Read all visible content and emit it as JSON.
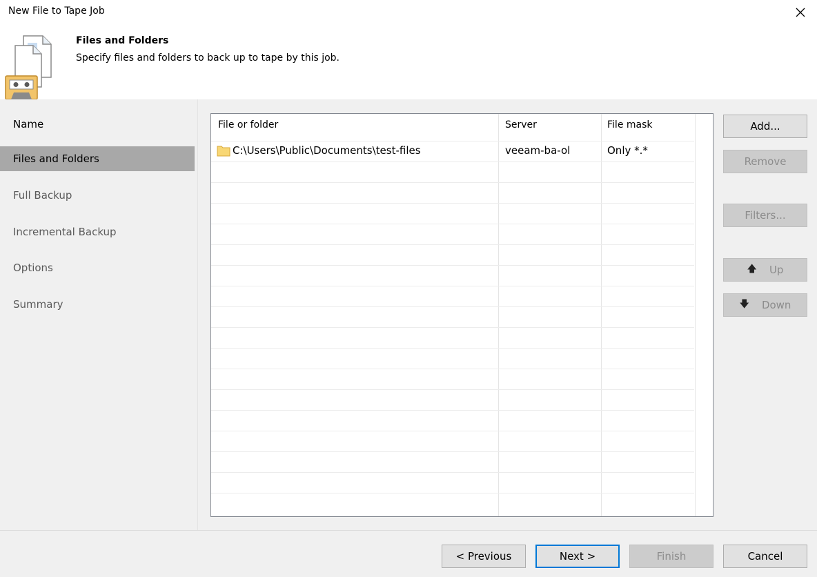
{
  "window": {
    "title": "New File to Tape Job",
    "close_icon": "close-icon"
  },
  "header": {
    "title": "Files and Folders",
    "description": "Specify files and folders to back up to tape by this job.",
    "icon": "file-to-tape-icon"
  },
  "steps": [
    {
      "label": "Name",
      "state": "done"
    },
    {
      "label": "Files and Folders",
      "state": "active"
    },
    {
      "label": "Full Backup",
      "state": "pending"
    },
    {
      "label": "Incremental Backup",
      "state": "pending"
    },
    {
      "label": "Options",
      "state": "pending"
    },
    {
      "label": "Summary",
      "state": "pending"
    }
  ],
  "table": {
    "columns": [
      "File or folder",
      "Server",
      "File mask"
    ],
    "rows": [
      {
        "path": "C:\\Users\\Public\\Documents\\test-files",
        "server": "veeam-ba-ol",
        "mask": "Only *.*",
        "icon": "folder-icon"
      }
    ]
  },
  "side_buttons": {
    "add": "Add...",
    "remove": "Remove",
    "filters": "Filters...",
    "up": "Up",
    "down": "Down"
  },
  "footer": {
    "previous": "< Previous",
    "next": "Next >",
    "finish": "Finish",
    "cancel": "Cancel"
  }
}
